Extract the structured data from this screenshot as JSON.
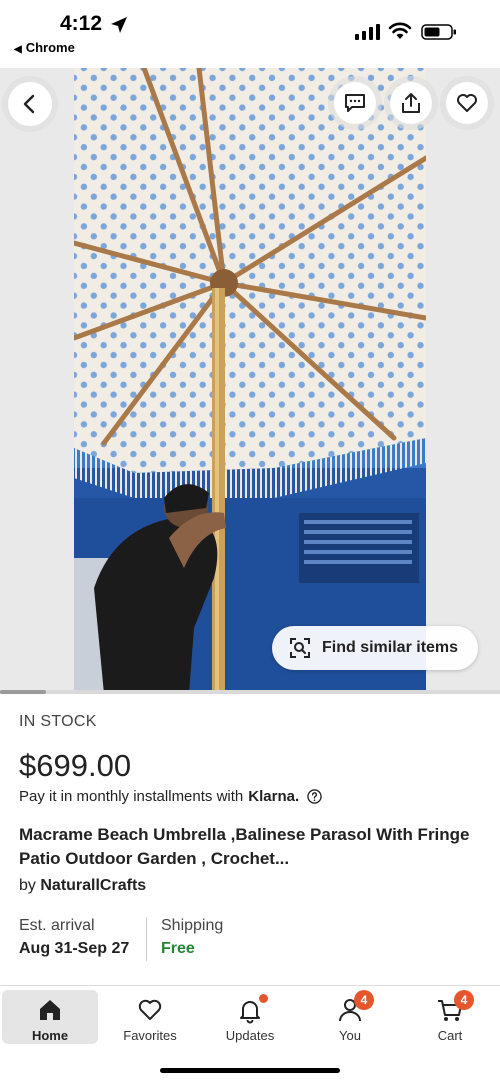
{
  "status_bar": {
    "time": "4:12",
    "back_app": "Chrome"
  },
  "media": {
    "find_similar_label": "Find similar items",
    "icons": {
      "back": "chevron-left-icon",
      "message": "message-icon",
      "share": "share-icon",
      "favorite": "heart-icon",
      "find_similar": "visual-search-icon"
    }
  },
  "product": {
    "stock_status": "IN STOCK",
    "price": "$699.00",
    "installments_text": "Pay it in monthly installments with",
    "installments_provider": "Klarna.",
    "title": "Macrame Beach Umbrella ,Balinese Parasol  With Fringe Patio Outdoor Garden , Crochet...",
    "by_prefix": "by",
    "shop_name": "NaturallCrafts",
    "est_arrival_label": "Est. arrival",
    "est_arrival_value": "Aug 31-Sep 27",
    "shipping_label": "Shipping",
    "shipping_value": "Free"
  },
  "colors": {
    "accent_orange": "#e4572e",
    "free_green": "#258635"
  },
  "tab_bar": {
    "tabs": [
      {
        "label": "Home",
        "icon": "home-icon",
        "active": true
      },
      {
        "label": "Favorites",
        "icon": "heart-icon"
      },
      {
        "label": "Updates",
        "icon": "bell-icon",
        "has_dot": true
      },
      {
        "label": "You",
        "icon": "person-icon",
        "badge": "4"
      },
      {
        "label": "Cart",
        "icon": "cart-icon",
        "badge": "4"
      }
    ]
  }
}
